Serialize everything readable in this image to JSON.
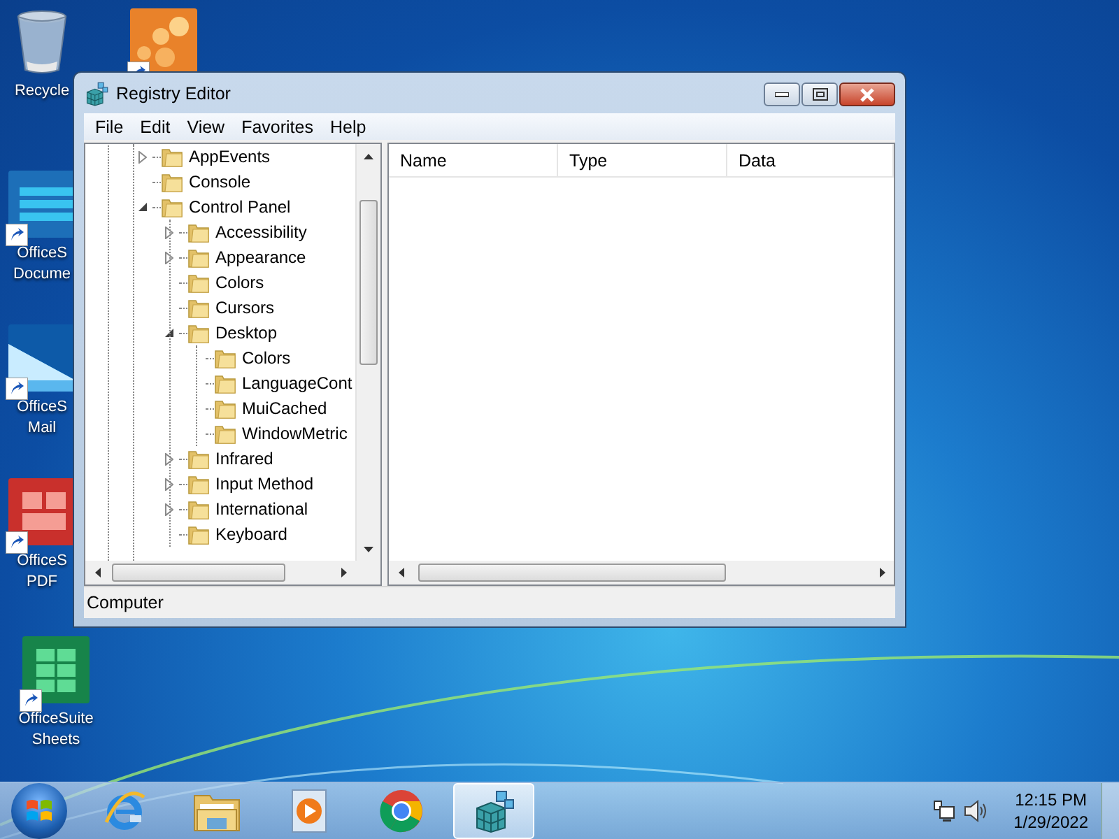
{
  "desktop_icons": [
    {
      "kind": "recycle",
      "label_lines": [
        "Recycle"
      ],
      "shortcut": false
    },
    {
      "kind": "graph",
      "shortcut": true
    },
    {
      "kind": "document",
      "label_lines": [
        "OfficeS",
        "Docume"
      ],
      "shortcut": true
    },
    {
      "kind": "mail",
      "label_lines": [
        "OfficeS",
        "Mail"
      ],
      "shortcut": true
    },
    {
      "kind": "pdf",
      "label_lines": [
        "OfficeS",
        "PDF"
      ],
      "shortcut": true
    },
    {
      "kind": "sheets",
      "label_lines": [
        "OfficeSuite",
        "Sheets"
      ],
      "shortcut": true
    }
  ],
  "window": {
    "title": "Registry Editor",
    "menu": [
      "File",
      "Edit",
      "View",
      "Favorites",
      "Help"
    ],
    "tree": [
      {
        "label": "AppEvents",
        "expanded": false
      },
      {
        "label": "Console"
      },
      {
        "label": "Control Panel",
        "expanded": true,
        "children": [
          {
            "label": "Accessibility",
            "expanded": false
          },
          {
            "label": "Appearance",
            "expanded": false
          },
          {
            "label": "Colors"
          },
          {
            "label": "Cursors"
          },
          {
            "label": "Desktop",
            "expanded": true,
            "children": [
              {
                "label": "Colors"
              },
              {
                "label": "LanguageCont"
              },
              {
                "label": "MuiCached"
              },
              {
                "label": "WindowMetric"
              }
            ]
          },
          {
            "label": "Infrared",
            "expanded": false
          },
          {
            "label": "Input Method",
            "expanded": false
          },
          {
            "label": "International",
            "expanded": false
          },
          {
            "label": "Keyboard"
          }
        ]
      }
    ],
    "columns": [
      "Name",
      "Type",
      "Data"
    ],
    "status_bar": "Computer"
  },
  "taskbar": {
    "apps": [
      {
        "kind": "ie",
        "selected": false
      },
      {
        "kind": "explorer",
        "selected": false
      },
      {
        "kind": "media",
        "selected": false
      },
      {
        "kind": "chrome",
        "selected": false
      },
      {
        "kind": "regedit",
        "selected": true
      }
    ],
    "time": "12:15 PM",
    "date": "1/29/2022"
  }
}
